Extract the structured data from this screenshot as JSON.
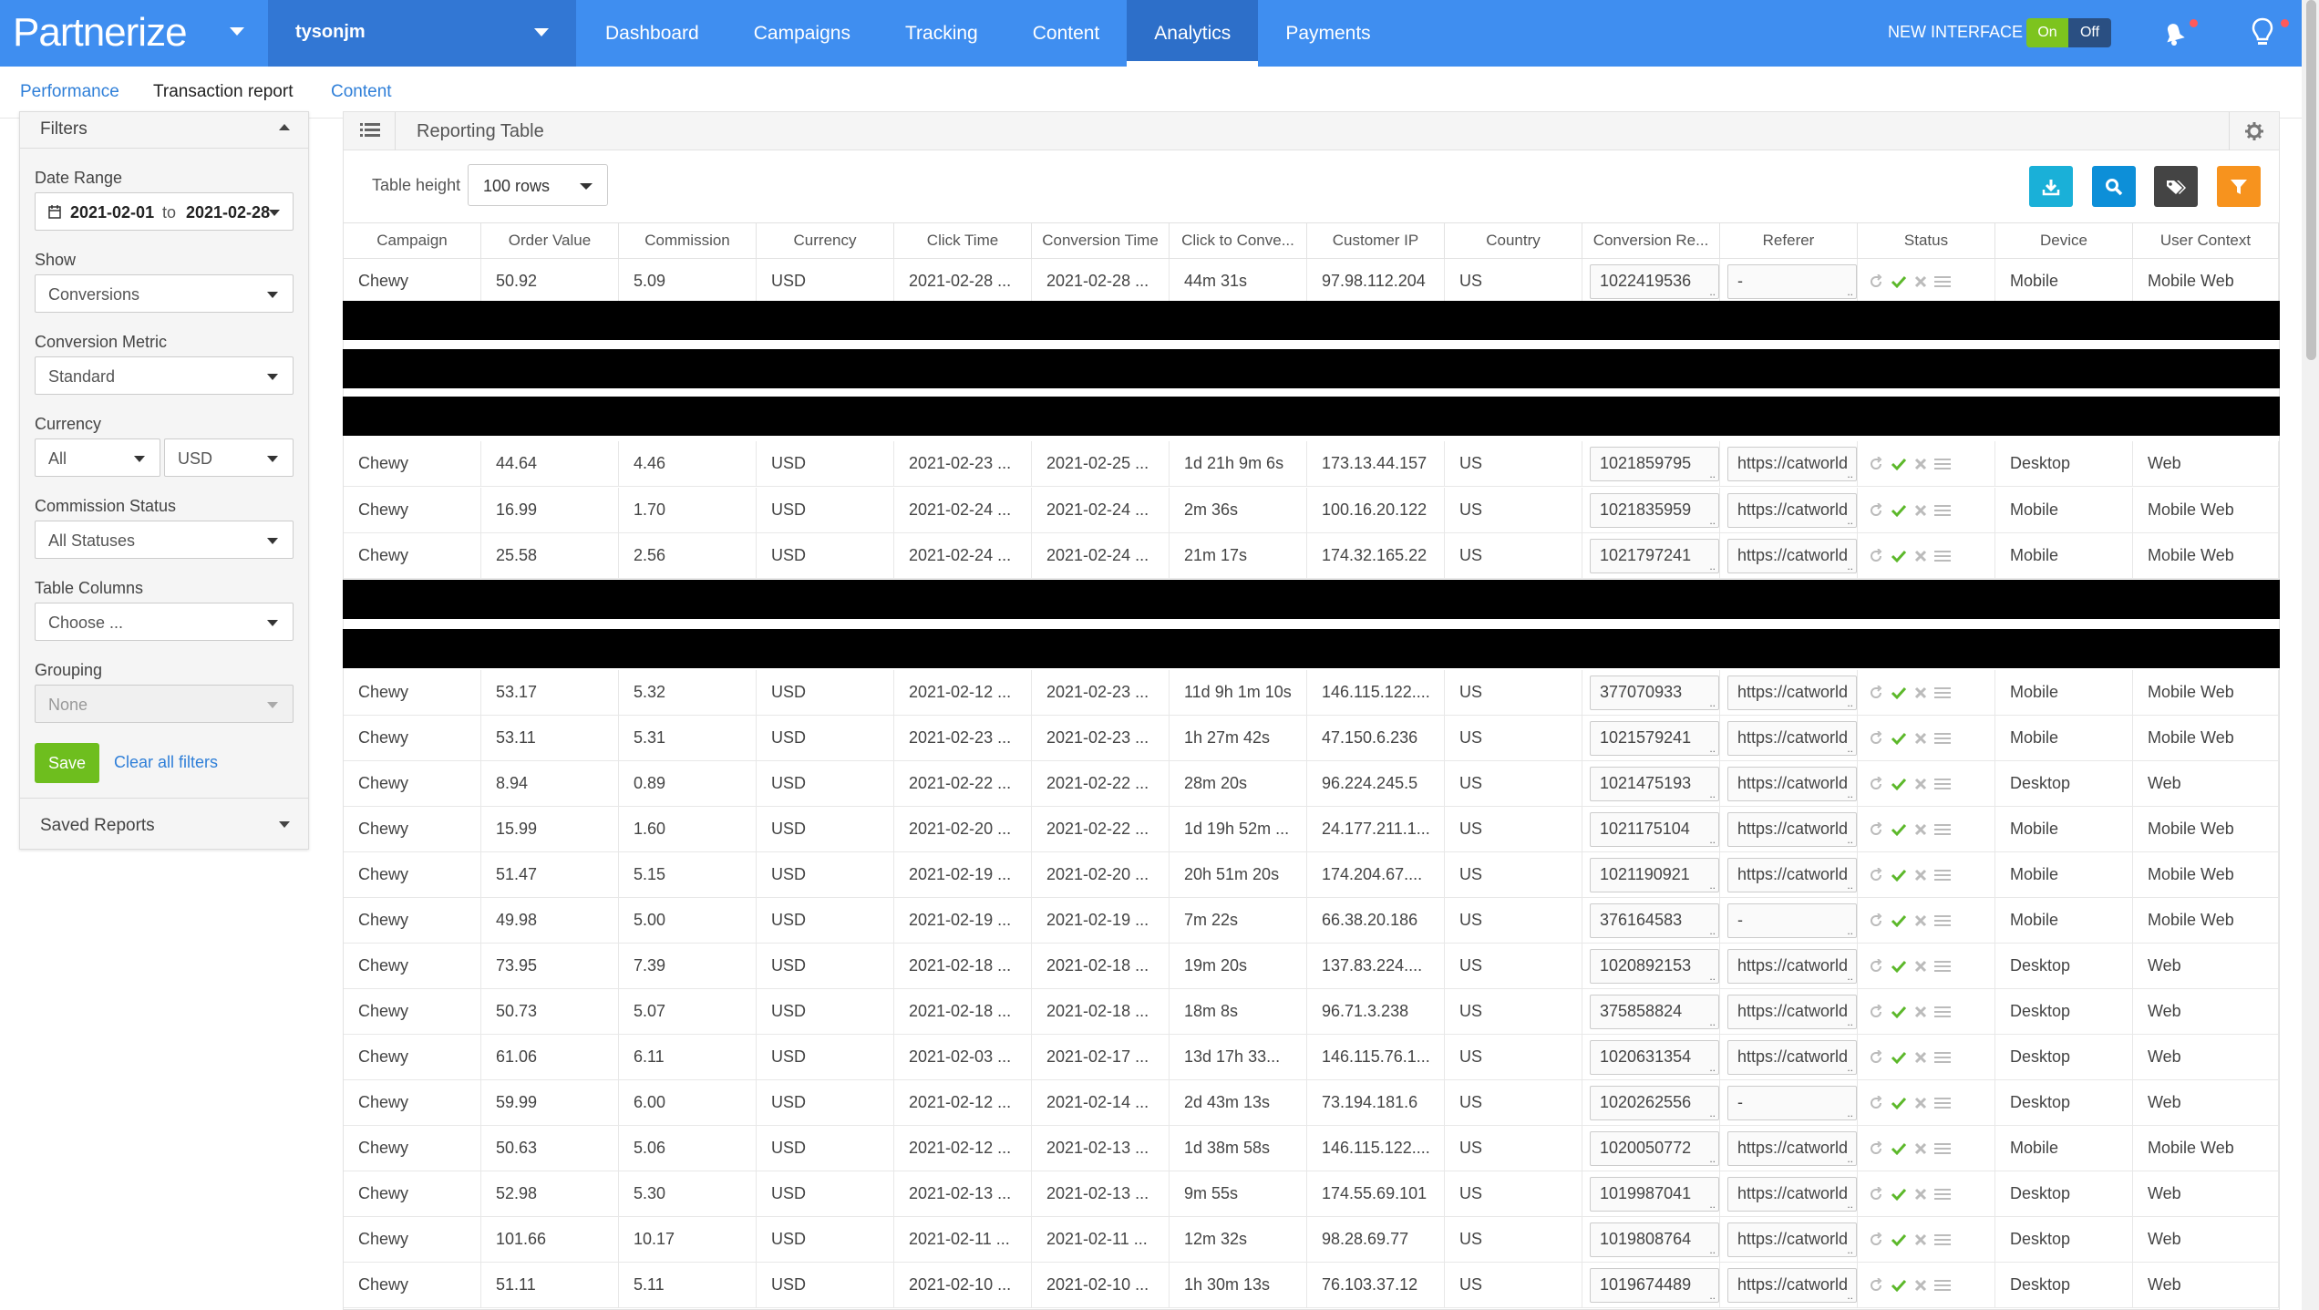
{
  "header": {
    "logo_text": "Partnerize",
    "account": "tysonjm",
    "nav": [
      "Dashboard",
      "Campaigns",
      "Tracking",
      "Content",
      "Analytics",
      "Payments"
    ],
    "active_nav": "Analytics",
    "new_interface_label": "NEW INTERFACE",
    "toggle_on": "On",
    "toggle_off": "Off"
  },
  "subnav": {
    "items": [
      "Performance",
      "Transaction report",
      "Content"
    ]
  },
  "sidebar": {
    "filters_title": "Filters",
    "date_range_label": "Date Range",
    "date_from": "2021-02-01",
    "date_to_word": "to",
    "date_to": "2021-02-28",
    "show_label": "Show",
    "show_value": "Conversions",
    "conversion_metric_label": "Conversion Metric",
    "conversion_metric_value": "Standard",
    "currency_label": "Currency",
    "currency_value_1": "All",
    "currency_value_2": "USD",
    "commission_status_label": "Commission Status",
    "commission_status_value": "All Statuses",
    "table_columns_label": "Table Columns",
    "table_columns_value": "Choose ...",
    "grouping_label": "Grouping",
    "grouping_value": "None",
    "save_label": "Save",
    "clear_label": "Clear all filters",
    "saved_reports_title": "Saved Reports"
  },
  "panel": {
    "title": "Reporting Table",
    "table_height_label": "Table height",
    "table_height_value": "100 rows"
  },
  "colors": {
    "nav_blue": "#3f8ef0",
    "download_btn": "#1ab0d8",
    "search_btn": "#0d8fd8",
    "tag_btn": "#444444",
    "filter_btn": "#f7931e",
    "save_green": "#6ebe1e"
  },
  "table": {
    "columns": [
      "Campaign",
      "Order Value",
      "Commission",
      "Currency",
      "Click Time",
      "Conversion Time",
      "Click to Conve...",
      "Customer IP",
      "Country",
      "Conversion Re...",
      "Referer",
      "Status",
      "Device",
      "User Context"
    ],
    "rows": [
      [
        "Chewy",
        "50.92",
        "5.09",
        "USD",
        "2021-02-28 ...",
        "2021-02-28 ...",
        "44m 31s",
        "97.98.112.204",
        "US",
        "1022419536",
        "-",
        "",
        "Mobile",
        "Mobile Web"
      ],
      [
        "Chewy",
        "44.64",
        "4.46",
        "USD",
        "2021-02-23 ...",
        "2021-02-25 ...",
        "1d 21h 9m 6s",
        "173.13.44.157",
        "US",
        "1021859795",
        "https://catworld",
        "",
        "Desktop",
        "Web"
      ],
      [
        "Chewy",
        "16.99",
        "1.70",
        "USD",
        "2021-02-24 ...",
        "2021-02-24 ...",
        "2m 36s",
        "100.16.20.122",
        "US",
        "1021835959",
        "https://catworld",
        "",
        "Mobile",
        "Mobile Web"
      ],
      [
        "Chewy",
        "25.58",
        "2.56",
        "USD",
        "2021-02-24 ...",
        "2021-02-24 ...",
        "21m 17s",
        "174.32.165.22",
        "US",
        "1021797241",
        "https://catworld",
        "",
        "Mobile",
        "Mobile Web"
      ],
      [
        "Chewy",
        "53.17",
        "5.32",
        "USD",
        "2021-02-12 ...",
        "2021-02-23 ...",
        "11d 9h 1m 10s",
        "146.115.122....",
        "US",
        "377070933",
        "https://catworld",
        "",
        "Mobile",
        "Mobile Web"
      ],
      [
        "Chewy",
        "53.11",
        "5.31",
        "USD",
        "2021-02-23 ...",
        "2021-02-23 ...",
        "1h 27m 42s",
        "47.150.6.236",
        "US",
        "1021579241",
        "https://catworld",
        "",
        "Mobile",
        "Mobile Web"
      ],
      [
        "Chewy",
        "8.94",
        "0.89",
        "USD",
        "2021-02-22 ...",
        "2021-02-22 ...",
        "28m 20s",
        "96.224.245.5",
        "US",
        "1021475193",
        "https://catworld",
        "",
        "Desktop",
        "Web"
      ],
      [
        "Chewy",
        "15.99",
        "1.60",
        "USD",
        "2021-02-20 ...",
        "2021-02-22 ...",
        "1d 19h 52m ...",
        "24.177.211.1...",
        "US",
        "1021175104",
        "https://catworld",
        "",
        "Mobile",
        "Mobile Web"
      ],
      [
        "Chewy",
        "51.47",
        "5.15",
        "USD",
        "2021-02-19 ...",
        "2021-02-20 ...",
        "20h 51m 20s",
        "174.204.67....",
        "US",
        "1021190921",
        "https://catworld",
        "",
        "Mobile",
        "Mobile Web"
      ],
      [
        "Chewy",
        "49.98",
        "5.00",
        "USD",
        "2021-02-19 ...",
        "2021-02-19 ...",
        "7m 22s",
        "66.38.20.186",
        "US",
        "376164583",
        "-",
        "",
        "Mobile",
        "Mobile Web"
      ],
      [
        "Chewy",
        "73.95",
        "7.39",
        "USD",
        "2021-02-18 ...",
        "2021-02-18 ...",
        "19m 20s",
        "137.83.224....",
        "US",
        "1020892153",
        "https://catworld",
        "",
        "Desktop",
        "Web"
      ],
      [
        "Chewy",
        "50.73",
        "5.07",
        "USD",
        "2021-02-18 ...",
        "2021-02-18 ...",
        "18m 8s",
        "96.71.3.238",
        "US",
        "375858824",
        "https://catworld",
        "",
        "Desktop",
        "Web"
      ],
      [
        "Chewy",
        "61.06",
        "6.11",
        "USD",
        "2021-02-03 ...",
        "2021-02-17 ...",
        "13d 17h 33...",
        "146.115.76.1...",
        "US",
        "1020631354",
        "https://catworld",
        "",
        "Desktop",
        "Web"
      ],
      [
        "Chewy",
        "59.99",
        "6.00",
        "USD",
        "2021-02-12 ...",
        "2021-02-14 ...",
        "2d 43m 13s",
        "73.194.181.6",
        "US",
        "1020262556",
        "-",
        "",
        "Desktop",
        "Web"
      ],
      [
        "Chewy",
        "50.63",
        "5.06",
        "USD",
        "2021-02-12 ...",
        "2021-02-13 ...",
        "1d 38m 58s",
        "146.115.122....",
        "US",
        "1020050772",
        "https://catworld",
        "",
        "Mobile",
        "Mobile Web"
      ],
      [
        "Chewy",
        "52.98",
        "5.30",
        "USD",
        "2021-02-13 ...",
        "2021-02-13 ...",
        "9m 55s",
        "174.55.69.101",
        "US",
        "1019987041",
        "https://catworld",
        "",
        "Desktop",
        "Web"
      ],
      [
        "Chewy",
        "101.66",
        "10.17",
        "USD",
        "2021-02-11 ...",
        "2021-02-11 ...",
        "12m 32s",
        "98.28.69.77",
        "US",
        "1019808764",
        "https://catworld",
        "",
        "Desktop",
        "Web"
      ],
      [
        "Chewy",
        "51.11",
        "5.11",
        "USD",
        "2021-02-10 ...",
        "2021-02-10 ...",
        "1h 30m 13s",
        "76.103.37.12",
        "US",
        "1019674489",
        "https://catworld",
        "",
        "Desktop",
        "Web"
      ]
    ]
  }
}
